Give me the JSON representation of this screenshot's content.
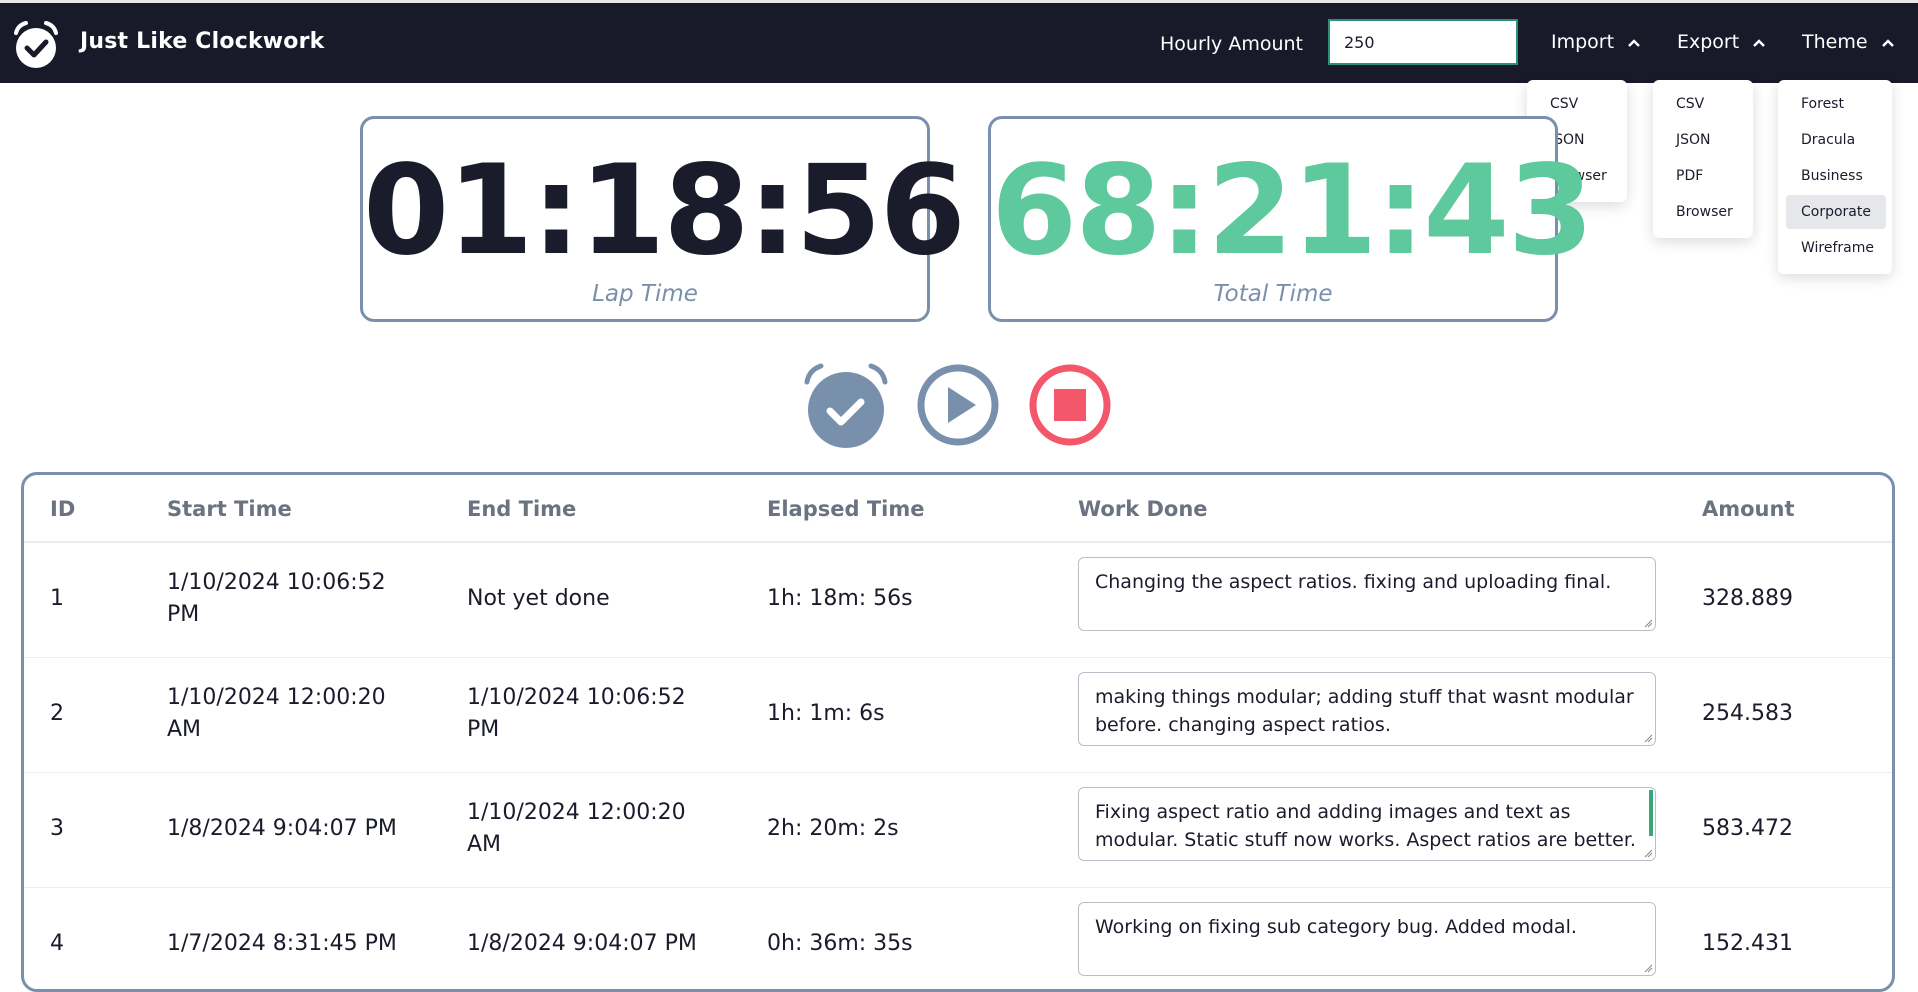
{
  "app": {
    "title": "Just Like Clockwork"
  },
  "header": {
    "hourly_label": "Hourly Amount",
    "hourly_value": "250",
    "menus": [
      {
        "label": "Import",
        "items": [
          "CSV",
          "JSON",
          "Browser"
        ]
      },
      {
        "label": "Export",
        "items": [
          "CSV",
          "JSON",
          "PDF",
          "Browser"
        ]
      },
      {
        "label": "Theme",
        "items": [
          "Forest",
          "Dracula",
          "Business",
          "Corporate",
          "Wireframe"
        ],
        "active": "Corporate"
      }
    ]
  },
  "timers": {
    "lap": {
      "value": "01:18:56",
      "label": "Lap Time"
    },
    "total": {
      "value": "68:21:43",
      "label": "Total Time"
    }
  },
  "controls": [
    "alarm-check-icon",
    "play-icon",
    "stop-icon"
  ],
  "colors": {
    "navbar": "#181a2a",
    "accent_green": "#5dc99c",
    "slate": "#7990ad",
    "stop_red": "#f4566a"
  },
  "table": {
    "headers": [
      "ID",
      "Start Time",
      "End Time",
      "Elapsed Time",
      "Work Done",
      "Amount"
    ],
    "rows": [
      {
        "id": "1",
        "start": "1/10/2024 10:06:52 PM",
        "end": "Not yet done",
        "elapsed": "1h: 18m: 56s",
        "work": "Changing the aspect ratios. fixing and uploading final.",
        "amount": "328.889"
      },
      {
        "id": "2",
        "start": "1/10/2024 12:00:20 AM",
        "end": "1/10/2024 10:06:52 PM",
        "elapsed": "1h: 1m: 6s",
        "work": "making things modular; adding stuff that wasnt modular before. changing aspect ratios.",
        "amount": "254.583"
      },
      {
        "id": "3",
        "start": "1/8/2024 9:04:07 PM",
        "end": "1/10/2024 12:00:20 AM",
        "elapsed": "2h: 20m: 2s",
        "work": "Fixing aspect ratio and adding images and text as modular. Static stuff now works. Aspect ratios are better. Making",
        "amount": "583.472"
      },
      {
        "id": "4",
        "start": "1/7/2024 8:31:45 PM",
        "end": "1/8/2024 9:04:07 PM",
        "elapsed": "0h: 36m: 35s",
        "work": "Working on fixing sub category bug. Added modal.",
        "amount": "152.431"
      }
    ]
  }
}
